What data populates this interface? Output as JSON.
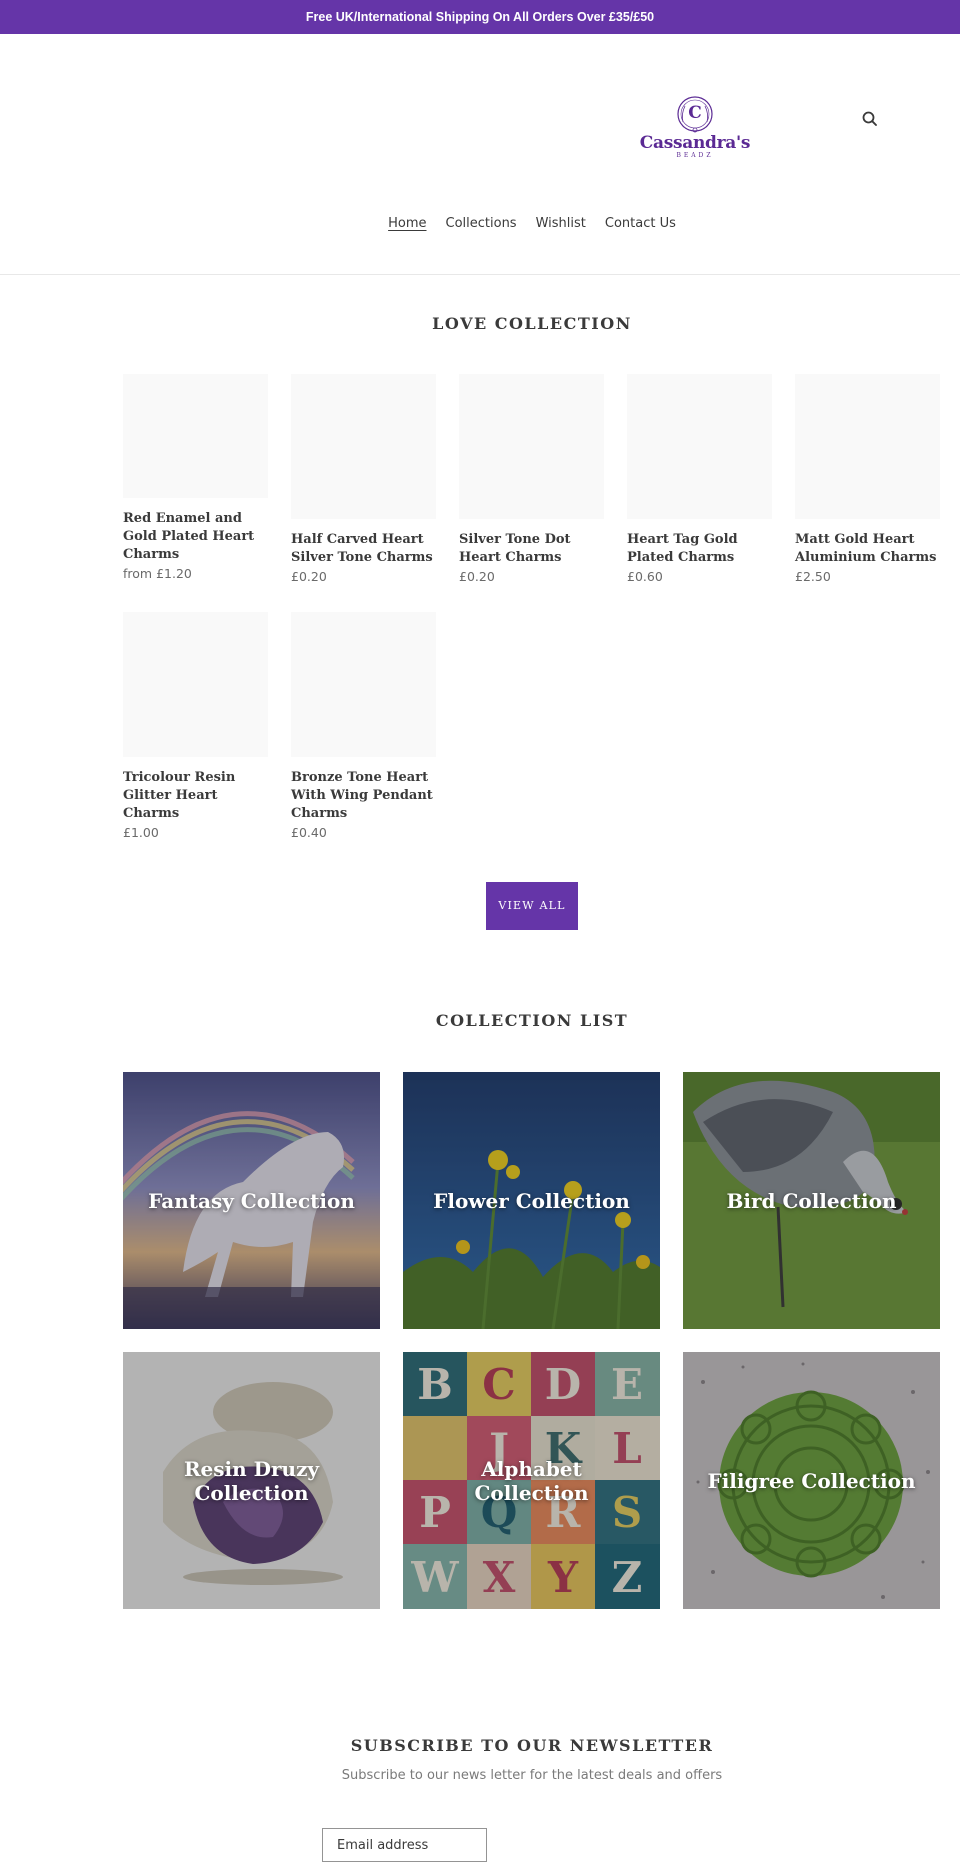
{
  "announcement": "Free UK/International Shipping On All Orders Over £35/£50",
  "logo": {
    "name": "Cassandra's",
    "sub": "BEADZ"
  },
  "icons": {
    "search": "search-icon",
    "logo_mark": "logo-c-icon"
  },
  "nav": [
    "Home",
    "Collections",
    "Wishlist",
    "Contact Us"
  ],
  "love_collection": {
    "title": "LOVE COLLECTION",
    "products": [
      {
        "title": "Red Enamel and Gold Plated Heart Charms",
        "price": "from £1.20"
      },
      {
        "title": "Half Carved Heart Silver Tone Charms",
        "price": "£0.20"
      },
      {
        "title": "Silver Tone Dot Heart Charms",
        "price": "£0.20"
      },
      {
        "title": "Heart Tag Gold Plated Charms",
        "price": "£0.60"
      },
      {
        "title": "Matt Gold Heart Aluminium Charms",
        "price": "£2.50"
      },
      {
        "title": "Tricolour Resin Glitter Heart Charms",
        "price": "£1.00"
      },
      {
        "title": "Bronze Tone Heart With Wing Pendant Charms",
        "price": "£0.40"
      }
    ],
    "view_all": "VIEW ALL"
  },
  "collection_list": {
    "title": "COLLECTION LIST",
    "items": [
      "Fantasy Collection",
      "Flower Collection",
      "Bird Collection",
      "Resin Druzy Collection",
      "Alphabet Collection",
      "Filigree Collection"
    ]
  },
  "newsletter": {
    "title": "SUBSCRIBE TO OUR NEWSLETTER",
    "subtitle": "Subscribe to our news letter for the latest deals and offers",
    "placeholder": "Email address"
  },
  "colors": {
    "accent": "#6535a8",
    "text": "#3a3a3a",
    "image_placeholder": "#f9f9f9"
  }
}
